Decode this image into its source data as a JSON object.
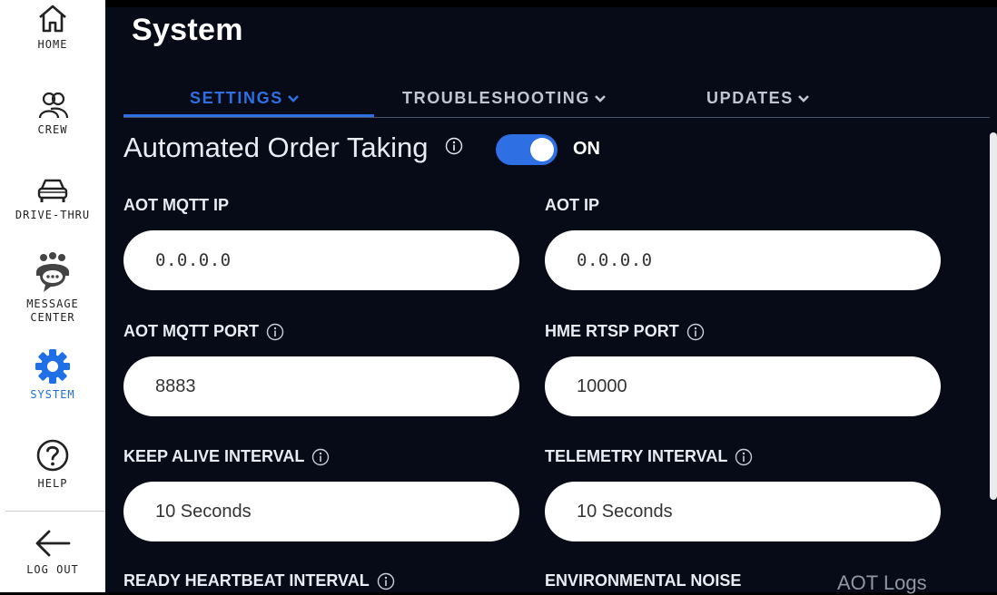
{
  "sidebar": {
    "items": [
      {
        "label": "HOME",
        "icon": "home-icon"
      },
      {
        "label": "CREW",
        "icon": "crew-icon"
      },
      {
        "label": "DRIVE-THRU",
        "icon": "car-icon"
      },
      {
        "label_line1": "MESSAGE",
        "label_line2": "CENTER",
        "icon": "message-center-icon"
      },
      {
        "label": "SYSTEM",
        "icon": "gear-icon",
        "active": true
      },
      {
        "label": "HELP",
        "icon": "help-icon"
      },
      {
        "label": "LOG OUT",
        "icon": "arrow-left-icon"
      }
    ]
  },
  "page": {
    "title": "System"
  },
  "tabs": [
    {
      "label": "SETTINGS",
      "active": true
    },
    {
      "label": "TROUBLESHOOTING"
    },
    {
      "label": "UPDATES"
    }
  ],
  "aot": {
    "title": "Automated Order Taking",
    "toggle_state": "ON",
    "toggle_on": true
  },
  "fields": {
    "aot_mqtt_ip": {
      "label": "AOT MQTT IP",
      "value": "0.0.0.0"
    },
    "aot_ip": {
      "label": "AOT IP",
      "value": "0.0.0.0"
    },
    "aot_mqtt_port": {
      "label": "AOT MQTT PORT",
      "value": "8883"
    },
    "hme_rtsp_port": {
      "label": "HME RTSP PORT",
      "value": "10000"
    },
    "keep_alive_interval": {
      "label": "KEEP ALIVE INTERVAL",
      "value": "10 Seconds"
    },
    "telemetry_interval": {
      "label": "TELEMETRY INTERVAL",
      "value": "10 Seconds"
    },
    "ready_heartbeat_interval": {
      "label": "READY HEARTBEAT INTERVAL"
    },
    "environmental_noise": {
      "label": "ENVIRONMENTAL NOISE"
    }
  },
  "links": {
    "aot_logs": "AOT Logs"
  },
  "colors": {
    "accent": "#2f6fe4",
    "background": "#070b17",
    "sidebar": "#ffffff"
  }
}
